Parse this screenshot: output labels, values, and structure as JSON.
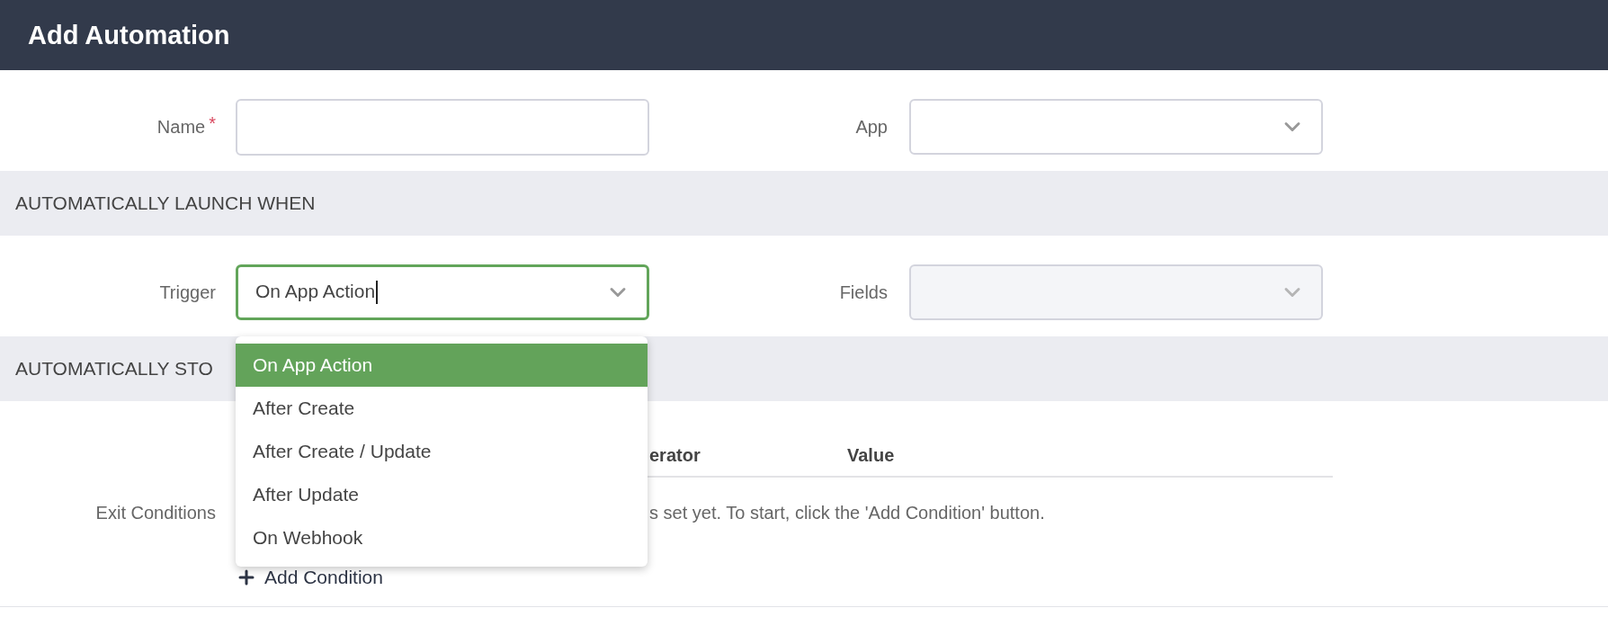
{
  "header": {
    "title": "Add Automation"
  },
  "general": {
    "fields": [
      {
        "kind": "text",
        "label": "Name",
        "required_mark": "*"
      },
      {
        "kind": "select",
        "label": "App",
        "disabled": false
      }
    ]
  },
  "launch_section": {
    "heading": "AUTOMATICALLY LAUNCH WHEN",
    "fields": [
      {
        "kind": "select",
        "label": "Trigger",
        "value": "On App Action",
        "focused": true,
        "disabled": false
      },
      {
        "kind": "select",
        "label": "Fields",
        "disabled": true
      }
    ]
  },
  "trigger_menu": {
    "options": [
      {
        "label": "On App Action",
        "selected": true
      },
      {
        "label": "After Create",
        "selected": false
      },
      {
        "label": "After Create / Update",
        "selected": false
      },
      {
        "label": "After Update",
        "selected": false
      },
      {
        "label": "On Webhook",
        "selected": false
      }
    ]
  },
  "stop_section": {
    "heading": "AUTOMATICALLY STO",
    "exit_conditions": {
      "label": "Exit Conditions",
      "columns": [
        "erator",
        "Value"
      ],
      "empty_message": "s set yet. To start, click the 'Add Condition' button.",
      "add_button": {
        "label": "Add Condition"
      }
    }
  }
}
